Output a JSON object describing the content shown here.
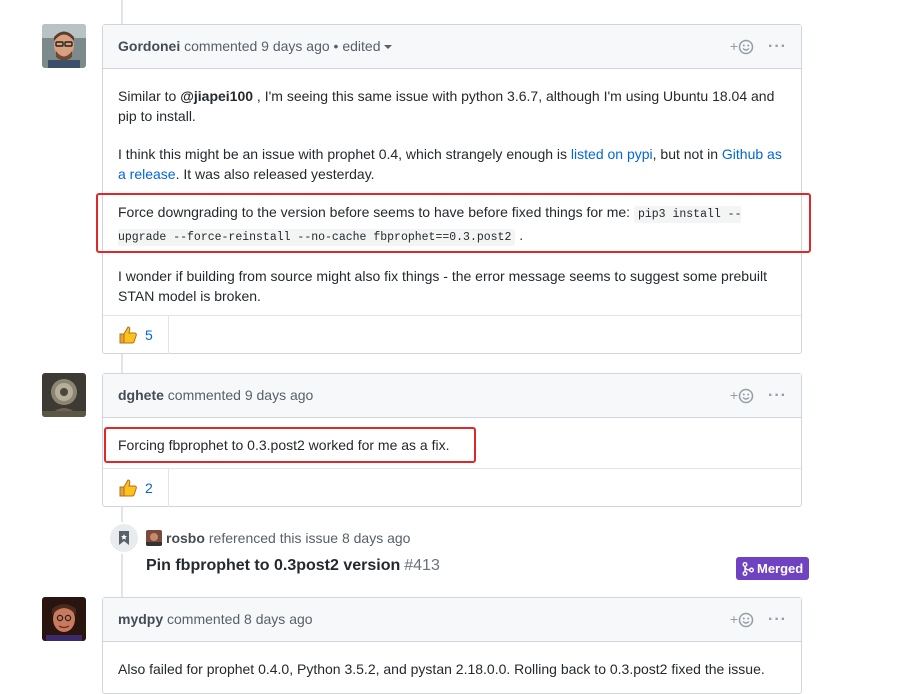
{
  "comments": [
    {
      "author": "Gordonei",
      "meta": "commented 9 days ago",
      "edited": "• edited",
      "body": {
        "p1_pre": "Similar to ",
        "p1_mention": "@jiapei100",
        "p1_post": " , I'm seeing this same issue with python 3.6.7, although I'm using Ubuntu 18.04 and pip to install.",
        "p2_pre": "I think this might be an issue with prophet 0.4, which strangely enough is ",
        "p2_link1": "listed on pypi",
        "p2_mid": ", but not in ",
        "p2_link2": "Github as a release",
        "p2_post": ". It was also released yesterday.",
        "p3_pre": "Force downgrading to the version before seems to have before fixed things for me: ",
        "p3_code": "pip3 install --upgrade --force-reinstall --no-cache fbprophet==0.3.post2",
        "p3_post": " .",
        "p4": "I wonder if building from source might also fix things - the error message seems to suggest some prebuilt STAN model is broken."
      },
      "reaction_count": "5"
    },
    {
      "author": "dghete",
      "meta": "commented 9 days ago",
      "body": "Forcing fbprophet to 0.3.post2 worked for me as a fix.",
      "reaction_count": "2"
    },
    {
      "author": "mydpy",
      "meta": "commented 8 days ago",
      "body": "Also failed for prophet 0.4.0, Python 3.5.2, and pystan 2.18.0.0. Rolling back to 0.3.post2 fixed the issue."
    }
  ],
  "reference": {
    "author": "rosbo",
    "text": "referenced this issue 8 days ago",
    "pr_title": "Pin fbprophet to 0.3post2 version",
    "pr_number": "#413",
    "status": "Merged"
  },
  "icons": {
    "add_reaction": "plus-smiley-icon",
    "more": "kebab-icon",
    "thumbs_up": "thumbs-up-icon",
    "bookmark": "bookmark-icon",
    "merge": "git-merge-icon"
  },
  "colors": {
    "link": "#0366d6",
    "highlight": "#e0282b",
    "merged": "#6f42c1"
  }
}
